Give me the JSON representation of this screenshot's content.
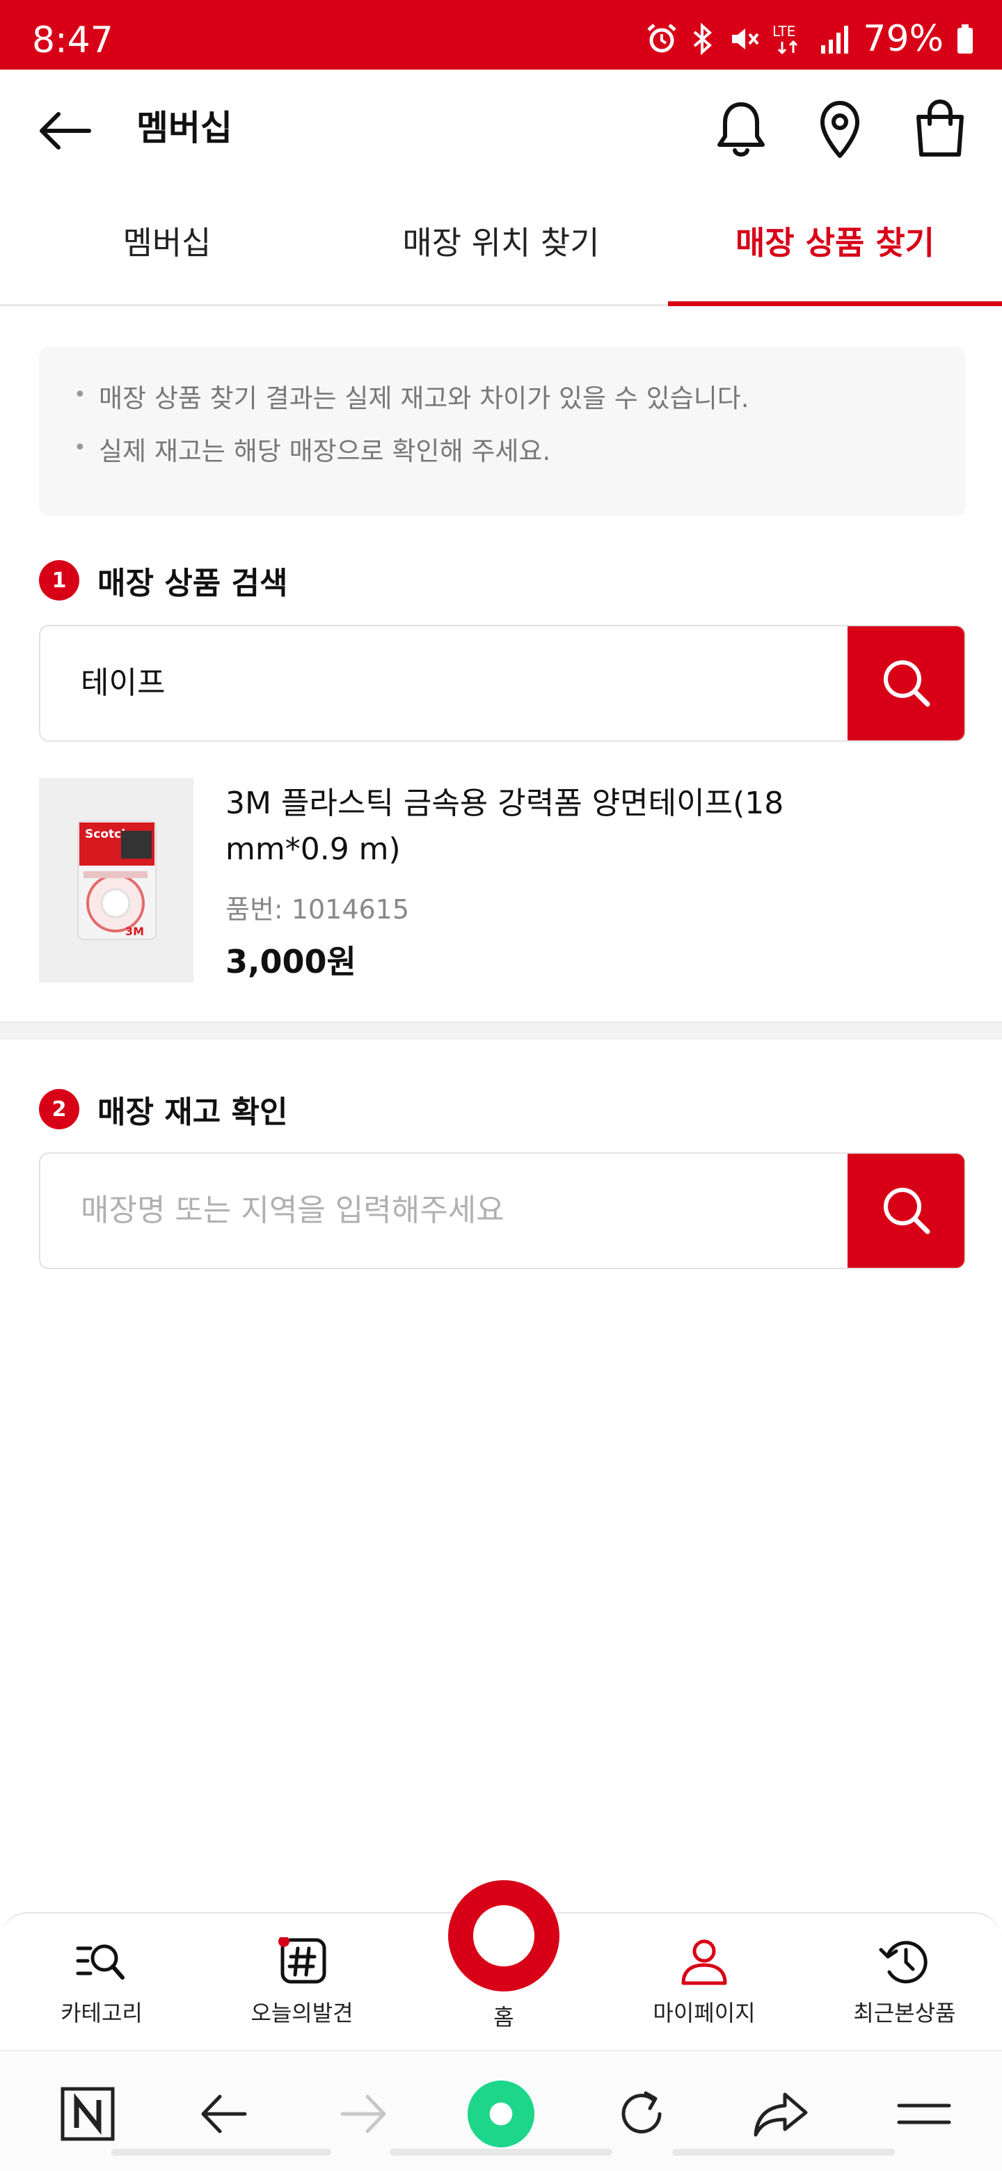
{
  "status_bar": {
    "time": "8:47",
    "network": "LTE",
    "battery": "79%"
  },
  "header": {
    "title": "멤버십"
  },
  "tabs": [
    {
      "label": "멤버십",
      "active": false
    },
    {
      "label": "매장 위치 찾기",
      "active": false
    },
    {
      "label": "매장 상품 찾기",
      "active": true
    }
  ],
  "notice": {
    "lines": [
      "매장 상품 찾기 결과는 실제 재고와 차이가 있을 수 있습니다.",
      "실제 재고는 해당 매장으로 확인해 주세요."
    ]
  },
  "section1": {
    "number": "1",
    "title": "매장 상품 검색",
    "search_value": "테이프",
    "search_placeholder": ""
  },
  "product": {
    "name": "3M 플라스틱 금속용 강력폼 양면테이프(18 mm*0.9 m)",
    "code": "품번: 1014615",
    "price": "3,000원",
    "image_brand": "Scotch"
  },
  "section2": {
    "number": "2",
    "title": "매장 재고 확인",
    "search_value": "",
    "search_placeholder": "매장명 또는 지역을 입력해주세요"
  },
  "bottom_nav": [
    {
      "label": "카테고리",
      "icon": "category-search-icon"
    },
    {
      "label": "오늘의발견",
      "icon": "hashtag-icon"
    },
    {
      "label": "홈",
      "icon": "home-ring-icon"
    },
    {
      "label": "마이페이지",
      "icon": "person-icon"
    },
    {
      "label": "최근본상품",
      "icon": "history-icon"
    }
  ],
  "colors": {
    "accent": "#d80017",
    "browser_home": "#1ed68a"
  }
}
